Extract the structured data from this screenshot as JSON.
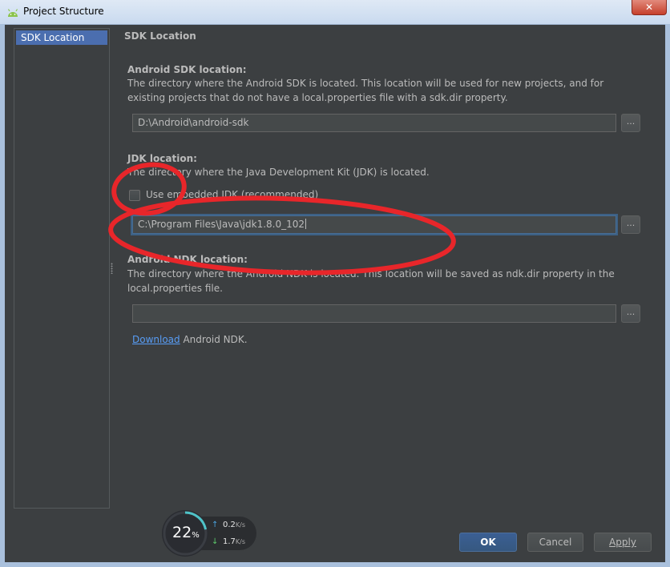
{
  "window": {
    "title": "Project Structure",
    "close_label": "✕"
  },
  "sidebar": {
    "items": [
      {
        "label": "SDK Location",
        "selected": true
      }
    ]
  },
  "main": {
    "page_title": "SDK Location",
    "android_sdk": {
      "title": "Android SDK location:",
      "description": "The directory where the Android SDK is located. This location will be used for new projects, and for existing projects that do not have a local.properties file with a sdk.dir property.",
      "value": "D:\\Android\\android-sdk",
      "browse_label": "..."
    },
    "jdk": {
      "title": "JDK location:",
      "description": "The directory where the Java Development Kit (JDK) is located.",
      "checkbox_label": "Use embedded JDK (recommended)",
      "checkbox_checked": false,
      "value": "C:\\Program Files\\Java\\jdk1.8.0_102",
      "browse_label": "..."
    },
    "ndk": {
      "title": "Android NDK location:",
      "description": "The directory where the Android NDK is located. This location will be saved as ndk.dir property in the local.properties file.",
      "value": "",
      "browse_label": "...",
      "download_link": "Download",
      "download_suffix": " Android NDK."
    }
  },
  "buttons": {
    "ok": "OK",
    "cancel": "Cancel",
    "apply": "Apply"
  },
  "widget": {
    "cpu_percent": "22",
    "percent_sign": "%",
    "upload": "0.2",
    "download": "1.7",
    "unit": "K/s",
    "upload_icon": "arrow-up-icon",
    "download_icon": "arrow-down-icon"
  },
  "colors": {
    "background": "#3c3f41",
    "selection": "#4b6eaf",
    "link": "#589df6",
    "annotation": "#e8262a"
  }
}
